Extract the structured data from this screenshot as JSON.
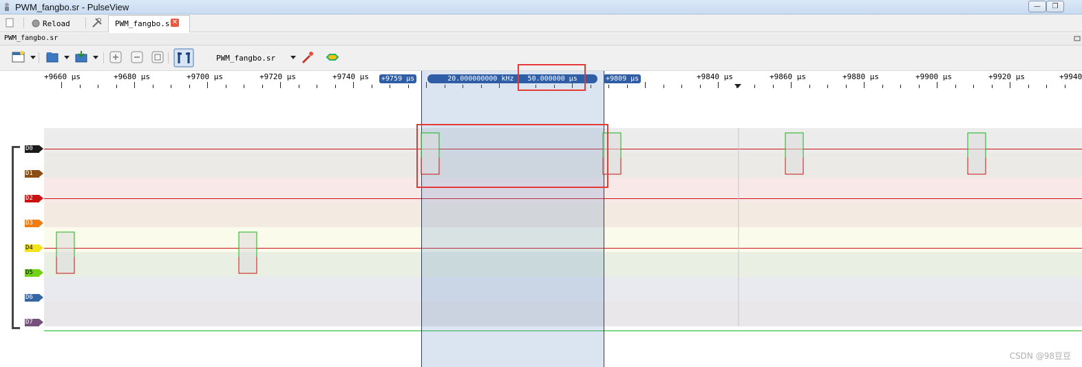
{
  "window": {
    "title": "PWM_fangbo.sr - PulseView",
    "minimize_label": "—",
    "maximize_label": "❐"
  },
  "tabbar": {
    "reload_label": "Reload",
    "file_tab_label": "PWM_fangbo.sr",
    "close_label": "✕"
  },
  "document": {
    "title": "PWM_fangbo.sr"
  },
  "toolbar": {
    "session_name": "PWM_fangbo.sr",
    "icons": [
      "new-session-icon",
      "open-icon",
      "save-icon",
      "zoom-in-icon",
      "zoom-out-icon",
      "zoom-fit-icon",
      "cursor-icon",
      "probe-icon",
      "decoder-icon"
    ]
  },
  "ruler": {
    "unit": "μs",
    "labels": [
      "+9660 μs",
      "+9680 μs",
      "+9700 μs",
      "+9720 μs",
      "+9740 μs",
      "+9840 μs",
      "+9860 μs",
      "+9880 μs",
      "+9900 μs",
      "+9920 μs",
      "+9940"
    ],
    "cursor_left_label": "+9759 μs",
    "cursor_right_label": "+9809 μs",
    "frequency_label": "20.000000000 kHz",
    "period_label": "50.000000  μs"
  },
  "channels": [
    {
      "label": "D0",
      "color": "#1a1a1a",
      "bg": "#ececec"
    },
    {
      "label": "D1",
      "color": "#8b4f16",
      "bg": "#eceae6"
    },
    {
      "label": "D2",
      "color": "#cc1111",
      "bg": "#f8e8e8"
    },
    {
      "label": "D3",
      "color": "#f07d14",
      "bg": "#f3ebe2"
    },
    {
      "label": "D4",
      "color": "#f3e31d",
      "bg": "#fbfbec"
    },
    {
      "label": "D5",
      "color": "#73d216",
      "bg": "#e9efe3"
    },
    {
      "label": "D6",
      "color": "#3465a4",
      "bg": "#e8eaef"
    },
    {
      "label": "D7",
      "color": "#75507b",
      "bg": "#eae7ea"
    }
  ],
  "watermark": "CSDN @98豆豆",
  "colors": {
    "trace_high": "#16b316",
    "trace_low": "#cc1111",
    "selection": "#7096c8",
    "annotation": "#e53935"
  }
}
